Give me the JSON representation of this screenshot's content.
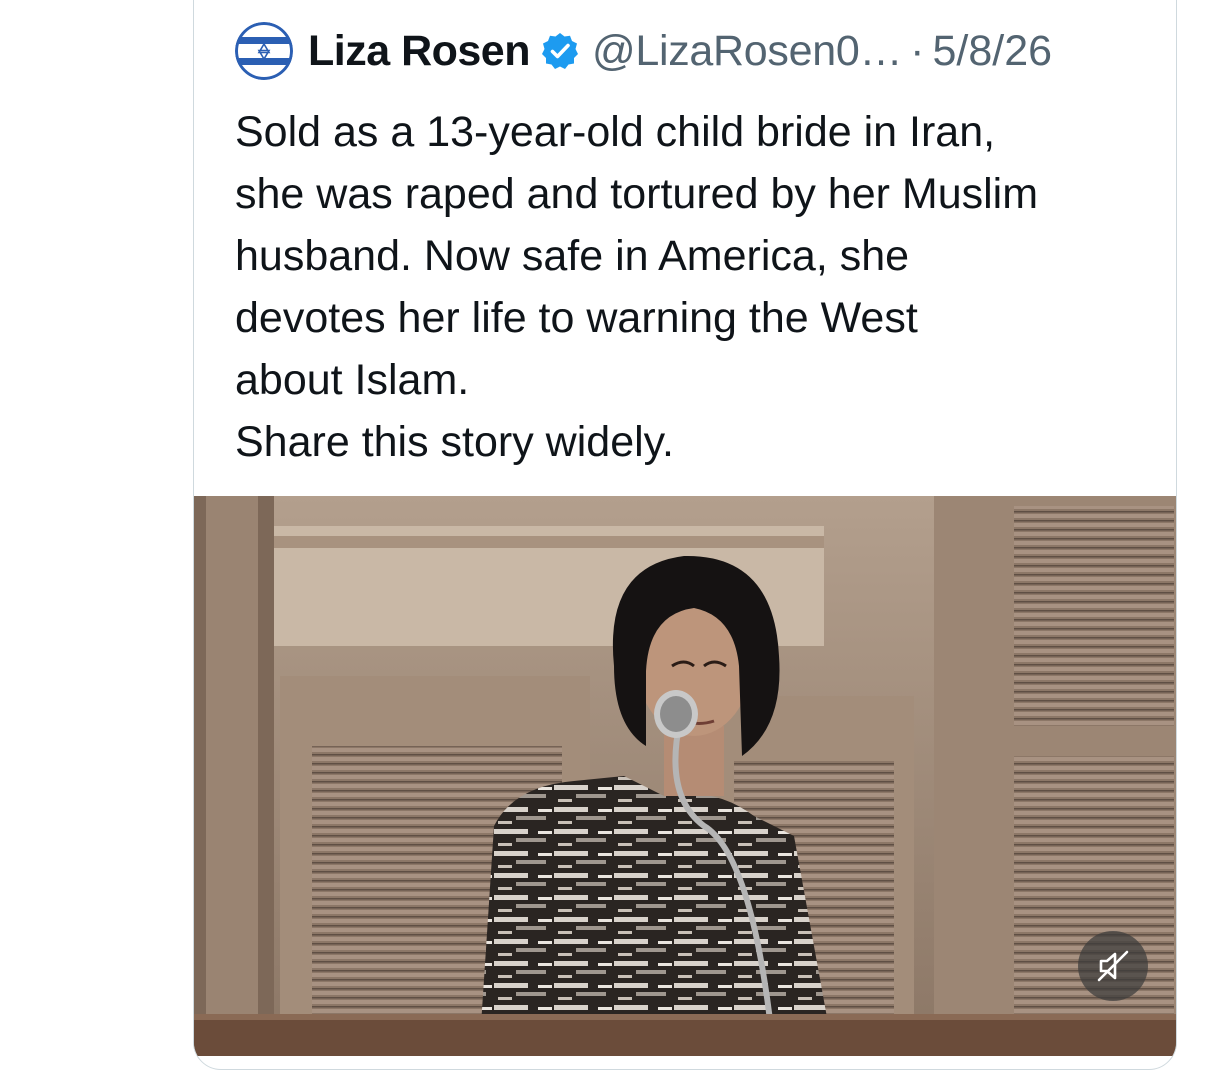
{
  "tweet": {
    "author_name": "Liza Rosen",
    "handle": "@LizaRosen0…",
    "separator": "·",
    "date": "5/8/26",
    "verified": true,
    "avatar_icon": "israel-flag-heart-icon",
    "text": "Sold as a 13-year-old child bride in Iran,\nshe was raped and tortured by her Muslim\nhusband. Now safe in America, she\ndevotes her life to warning the West\nabout Islam.\nShare this story widely."
  },
  "media": {
    "type": "video",
    "mute_icon": "speaker-muted-icon"
  },
  "colors": {
    "text_primary": "#0f1419",
    "text_secondary": "#536471",
    "verified_blue": "#1d9bf0",
    "card_border": "#cfd9de",
    "flag_blue": "#2b5fb3"
  }
}
